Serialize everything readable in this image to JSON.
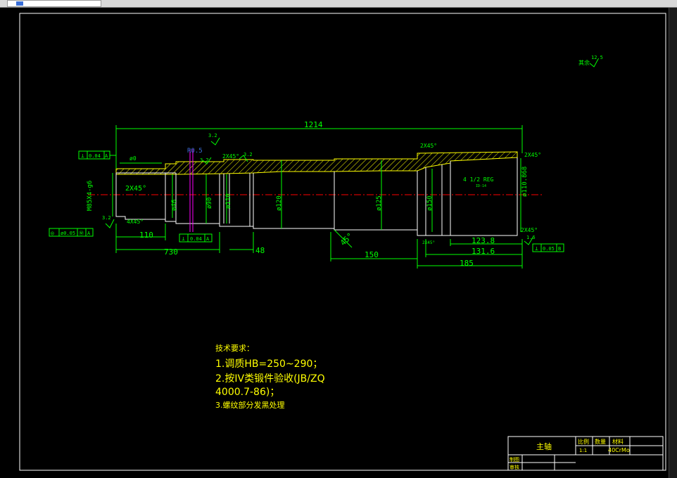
{
  "drawing": {
    "dimensions": {
      "overall_length": "1214",
      "d_730": "730",
      "d_110": "110",
      "d_48": "48",
      "d_150": "150",
      "d_185": "185",
      "d_123_8": "123.8",
      "d_131_6": "131.6",
      "diam_46": "ø46",
      "diam_90": "ø90",
      "diam_110": "ø110",
      "diam_120": "ø120",
      "diam_125": "ø125",
      "diam_150": "ø150",
      "diam_thread_end": "ø110.868",
      "thread_m85": "M85X4-g6",
      "dia_phi0": "ø0",
      "angle_45": "45°",
      "chamfer_left": "2X45°",
      "chamfer_left_small": "4X45°",
      "chamfer_mid": "2X45°",
      "chamfer_top_right": "2X45°",
      "chamfer_end_top": "2X45°",
      "chamfer_end_bottom": "2X45°",
      "chamfer_bottom_mid": "2X45°",
      "thread_reg": "4 1/2 REG",
      "thread_note": "ID-14",
      "radius_note": "R0.5",
      "rough_32a": "3.2",
      "rough_32b": "3.2",
      "rough_32c": "3.2",
      "rough_32d": "3.2",
      "rough_16": "1.6",
      "rough_rest": "其余",
      "rough_rest_val": "12.5"
    },
    "tolerances": {
      "flat_top": {
        "sym": "⊥",
        "val": "0.04",
        "datum": "A"
      },
      "mid_perp": {
        "sym": "⊥",
        "val": "0.04",
        "datum": "A"
      },
      "circ_left": {
        "sym": "◎",
        "val": "ø0.05",
        "sym2": "Ⓜ",
        "datum": "A"
      },
      "end_perp": {
        "sym": "⊥",
        "val": "0.05",
        "datum": "B"
      }
    },
    "requirements": {
      "title": "技术要求：",
      "line1": "1.调质HB=250~290；",
      "line2": "2.按IV类锻件验收(JB/ZQ",
      "line2b": "4000.7-86)；",
      "line3": "3.螺纹部分发黑处理"
    },
    "title_block": {
      "name": "主轴",
      "scale_label": "比例",
      "scale_val": "1:1",
      "qty_label": "数量",
      "material_label": "材料",
      "material_val": "40CrMo",
      "drawn_label": "制图",
      "checked_label": "审核"
    }
  },
  "colors": {
    "dimension": "#00ff00",
    "outline": "#ffffff",
    "section": "#ffff00",
    "centerline": "#ff0000",
    "accent_blue": "#3a6fd8",
    "magenta": "#ff00ff"
  }
}
